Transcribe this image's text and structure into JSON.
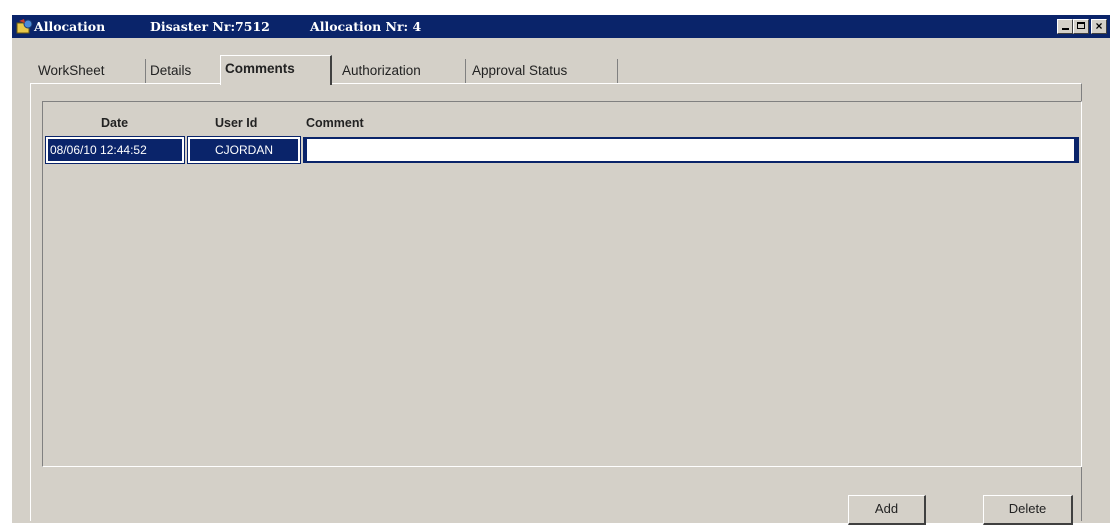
{
  "window": {
    "app_title": "Allocation",
    "disaster": "Disaster Nr:7512",
    "allocation": "Allocation Nr: 4",
    "minimize": "_",
    "close": "×"
  },
  "tabs": [
    {
      "label": "WorkSheet"
    },
    {
      "label": "Details"
    },
    {
      "label": "Comments",
      "active": true
    },
    {
      "label": "Authorization"
    },
    {
      "label": "Approval Status"
    }
  ],
  "grid": {
    "columns": [
      "Date",
      "User Id",
      "Comment"
    ],
    "rows": [
      {
        "date": "08/06/10 12:44:52",
        "user_id": "CJORDAN",
        "comment": ""
      }
    ]
  },
  "buttons": {
    "add": "Add",
    "delete": "Delete"
  },
  "colors": {
    "titlebar": "#0a246a",
    "face": "#d4d0c8",
    "selection": "#0a246a"
  },
  "icons": {
    "app": "allocation-app-icon",
    "minimize": "minimize-icon",
    "maximize": "maximize-icon",
    "close": "close-icon"
  }
}
